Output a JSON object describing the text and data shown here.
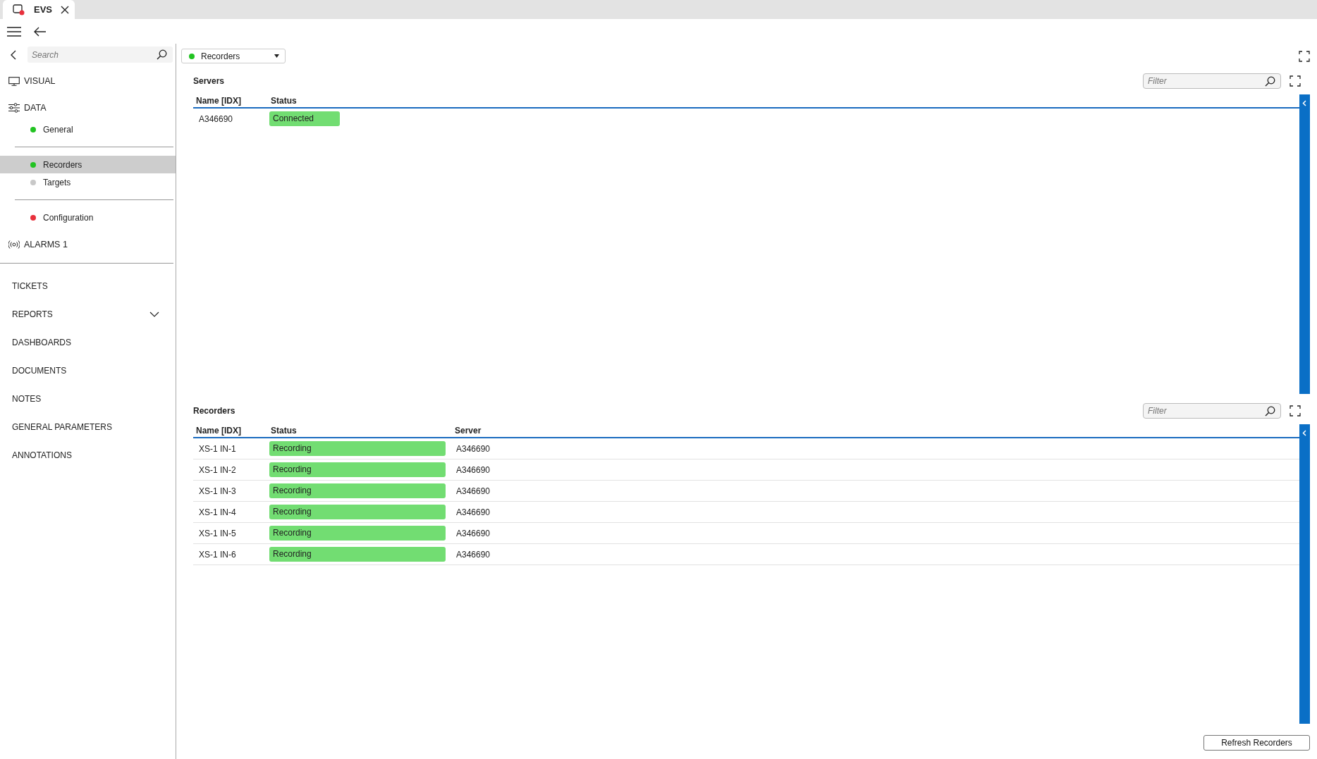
{
  "tab": {
    "title": "EVS"
  },
  "sidebar": {
    "search": {
      "placeholder": "Search"
    },
    "nav": [
      {
        "kind": "monitor",
        "label": "VISUAL"
      },
      {
        "kind": "sliders",
        "label": "DATA",
        "groups": [
          [
            {
              "label": "General",
              "color": "#22c322",
              "selected": false
            }
          ],
          [
            {
              "label": "Recorders",
              "color": "#22c322",
              "selected": true
            },
            {
              "label": "Targets",
              "color": "#c8c8c8",
              "selected": false
            }
          ],
          [
            {
              "label": "Configuration",
              "color": "#e8303c",
              "selected": false
            }
          ]
        ]
      },
      {
        "kind": "antenna",
        "label": "ALARMS 1"
      }
    ],
    "menu": [
      {
        "label": "TICKETS"
      },
      {
        "label": "REPORTS",
        "expanded": false
      },
      {
        "label": "DASHBOARDS"
      },
      {
        "label": "DOCUMENTS"
      },
      {
        "label": "NOTES"
      },
      {
        "label": "GENERAL PARAMETERS"
      },
      {
        "label": "ANNOTATIONS"
      }
    ]
  },
  "view_select": {
    "label": "Recorders",
    "color": "#22c322"
  },
  "sections": [
    {
      "title": "Servers",
      "filter_placeholder": "Filter",
      "columns": [
        "Name [IDX]",
        "Status"
      ],
      "rows": [
        {
          "cells": [
            "A346690",
            "Connected"
          ]
        }
      ]
    },
    {
      "title": "Recorders",
      "filter_placeholder": "Filter",
      "columns": [
        "Name [IDX]",
        "Status",
        "Server"
      ],
      "rows": [
        {
          "cells": [
            "XS-1 IN-1",
            "Recording",
            "A346690"
          ]
        },
        {
          "cells": [
            "XS-1 IN-2",
            "Recording",
            "A346690"
          ]
        },
        {
          "cells": [
            "XS-1 IN-3",
            "Recording",
            "A346690"
          ]
        },
        {
          "cells": [
            "XS-1 IN-4",
            "Recording",
            "A346690"
          ]
        },
        {
          "cells": [
            "XS-1 IN-5",
            "Recording",
            "A346690"
          ]
        },
        {
          "cells": [
            "XS-1 IN-6",
            "Recording",
            "A346690"
          ]
        }
      ]
    }
  ],
  "footer_button": "Refresh Recorders"
}
